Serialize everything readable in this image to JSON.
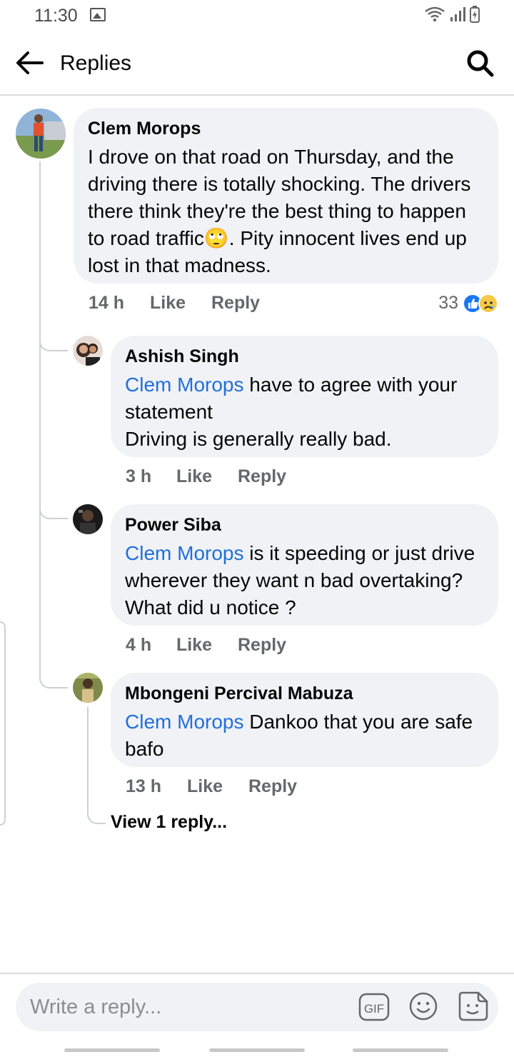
{
  "status_bar": {
    "time": "11:30"
  },
  "header": {
    "title": "Replies"
  },
  "comments": [
    {
      "author": "Clem Morops",
      "text_before": "I drove on that road on Thursday, and the driving there is totally shocking. The drivers there think they're the best thing to happen to road traffic",
      "emoji": "🙄",
      "text_after": ". Pity innocent lives end up lost in that madness.",
      "time": "14 h",
      "like": "Like",
      "reply": "Reply",
      "reaction_count": "33"
    },
    {
      "author": "Ashish Singh",
      "mention": "Clem Morops",
      "text": " have to agree with your statement\nDriving is generally really bad.",
      "time": "3 h",
      "like": "Like",
      "reply": "Reply"
    },
    {
      "author": "Power Siba",
      "mention": "Clem Morops",
      "text": " is it speeding or just drive wherever they want n bad overtaking? What did u notice ?",
      "time": "4 h",
      "like": "Like",
      "reply": "Reply"
    },
    {
      "author": "Mbongeni Percival Mabuza",
      "mention": "Clem Morops",
      "text": " Dankoo that you are safe bafo",
      "time": "13 h",
      "like": "Like",
      "reply": "Reply"
    }
  ],
  "view_more": "View 1 reply...",
  "composer": {
    "placeholder": "Write a reply...",
    "gif_label": "GIF"
  },
  "colors": {
    "mention": "#216fdb",
    "bubble": "#f0f2f5",
    "like_blue": "#1877f2"
  }
}
